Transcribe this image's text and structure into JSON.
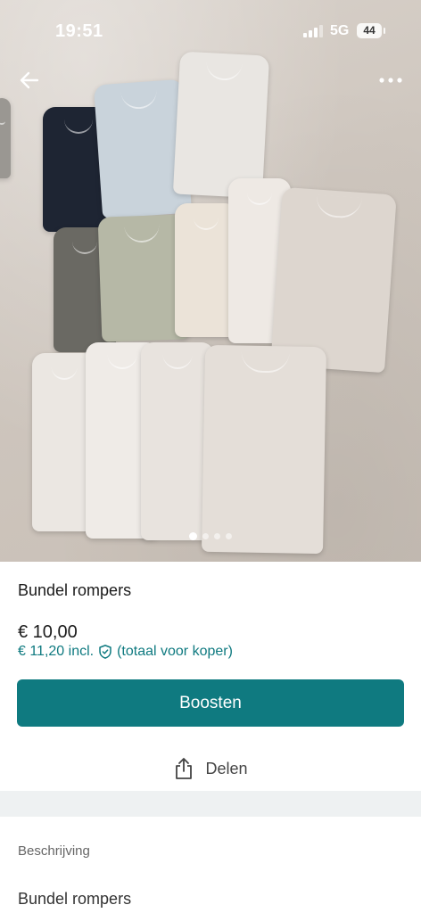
{
  "status_bar": {
    "time": "19:51",
    "network": "5G",
    "battery": "44"
  },
  "navigation": {
    "back_icon": "arrow-left-icon",
    "more_icon": "more-horizontal-icon"
  },
  "gallery": {
    "photo_count": 4,
    "active_index": 0
  },
  "listing": {
    "title": "Bundel rompers",
    "price": "€ 10,00",
    "price_incl": "€ 11,20 incl.",
    "price_incl_note": "(totaal voor koper)",
    "shield_icon": "shield-check-icon"
  },
  "actions": {
    "boost_label": "Boosten",
    "share_label": "Delen",
    "share_icon": "share-icon"
  },
  "description": {
    "label": "Beschrijving",
    "text": "Bundel rompers"
  },
  "colors": {
    "accent": "#0f7a80",
    "separator": "#eef1f2"
  }
}
